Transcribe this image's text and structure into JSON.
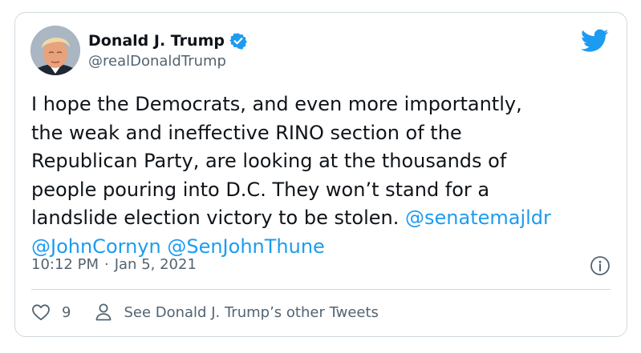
{
  "tweet": {
    "author": {
      "name": "Donald J. Trump",
      "handle": "@realDonaldTrump",
      "verified": true
    },
    "text": {
      "line1": "I hope the Democrats, and even more importantly,",
      "line2": "the weak and ineffective RINO section of the",
      "line3": "Republican Party, are looking at the thousands of",
      "line4": "people pouring into D.C. They won’t stand for a",
      "line5_plain": "landslide election victory to be stolen. ",
      "mention1": "@senatemajldr",
      "mention2": "@JohnCornyn",
      "mention3": "@SenJohnThune"
    },
    "time": "10:12 PM",
    "separator": "·",
    "date": "Jan 5, 2021"
  },
  "actions": {
    "like_count": "9",
    "other_tweets_label": "See Donald J. Trump’s other Tweets"
  },
  "icons": {
    "brand": "twitter-bird-icon",
    "verified": "verified-badge-icon",
    "info": "info-icon",
    "like": "heart-icon",
    "profile": "person-icon"
  },
  "colors": {
    "brand_blue": "#1d9bf0",
    "text": "#0f1419",
    "muted": "#536471",
    "border": "#cfd9de"
  }
}
